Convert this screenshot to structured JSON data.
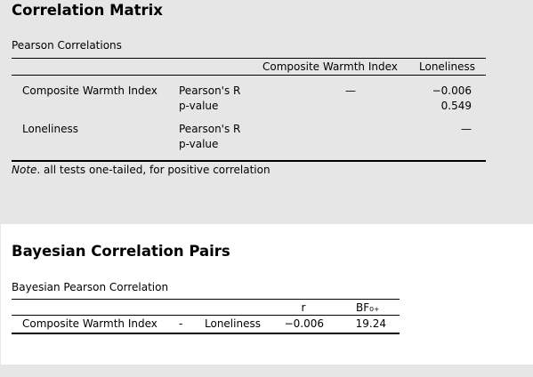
{
  "matrix": {
    "title": "Correlation Matrix",
    "subtitle": "Pearson Correlations",
    "col_headers": [
      "Composite Warmth Index",
      "Loneliness"
    ],
    "rows": [
      {
        "variable": "Composite Warmth Index",
        "stat1": "Pearson's R",
        "stat2": "p-value",
        "col1_r": "—",
        "col2_r": "−0.006",
        "col2_p": "0.549"
      },
      {
        "variable": "Loneliness",
        "stat1": "Pearson's R",
        "stat2": "p-value",
        "col2_r": "—"
      }
    ],
    "note_label": "Note",
    "note_text": ". all tests one-tailed, for positive correlation"
  },
  "bayes": {
    "title": "Bayesian Correlation Pairs",
    "subtitle": "Bayesian Pearson Correlation",
    "col_r": "r",
    "col_bf": "BF₀₊",
    "row": {
      "var1": "Composite Warmth Index",
      "sep": "-",
      "var2": "Loneliness",
      "r": "−0.006",
      "bf": "19.24"
    }
  }
}
